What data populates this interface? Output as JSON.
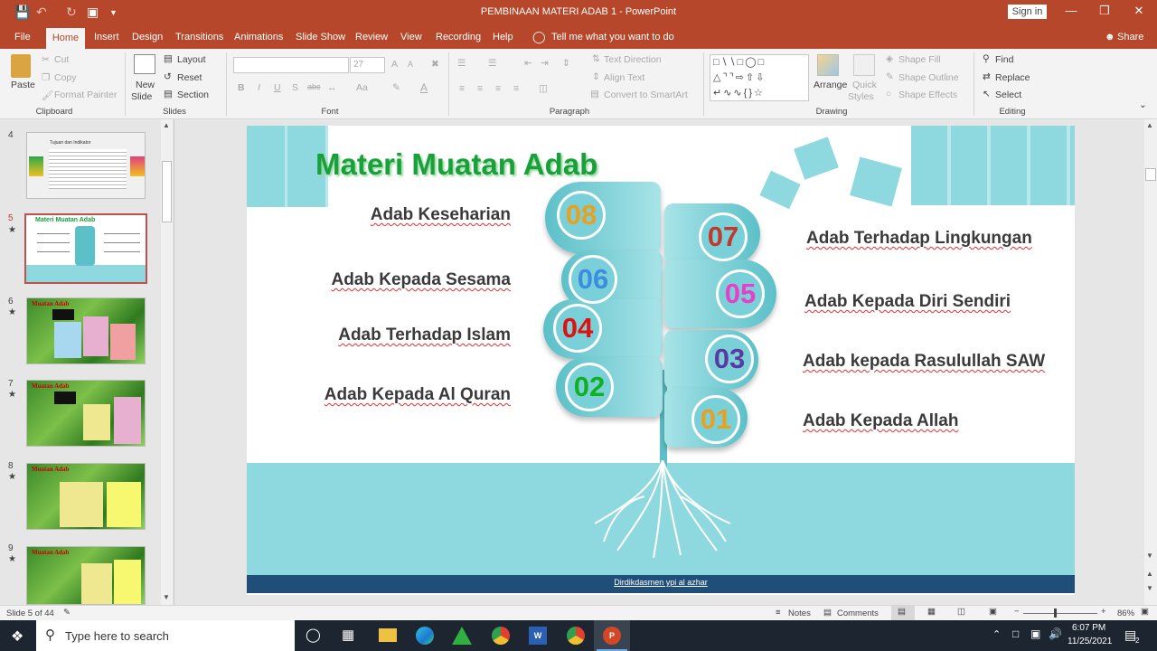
{
  "window": {
    "title": "PEMBINAAN MATERI ADAB 1  -  PowerPoint",
    "sign_in": "Sign in"
  },
  "menu": {
    "tabs": [
      "File",
      "Home",
      "Insert",
      "Design",
      "Transitions",
      "Animations",
      "Slide Show",
      "Review",
      "View",
      "Recording",
      "Help"
    ],
    "tell_me": "Tell me what you want to do",
    "share": "Share"
  },
  "ribbon": {
    "clipboard": {
      "paste": "Paste",
      "cut": "Cut",
      "copy": "Copy",
      "format_painter": "Format Painter",
      "label": "Clipboard"
    },
    "slides": {
      "new_slide_1": "New",
      "new_slide_2": "Slide",
      "layout": "Layout",
      "reset": "Reset",
      "section": "Section",
      "label": "Slides"
    },
    "font": {
      "size": "27",
      "label": "Font",
      "bold": "B",
      "italic": "I",
      "underline": "U",
      "shadow": "S",
      "strike": "abc",
      "grow": "A",
      "shrink": "A",
      "case": "Aa",
      "color": "A"
    },
    "paragraph": {
      "text_direction": "Text Direction",
      "align_text": "Align Text",
      "convert_smartart": "Convert to SmartArt",
      "label": "Paragraph"
    },
    "drawing": {
      "arrange": "Arrange",
      "quick_styles_1": "Quick",
      "quick_styles_2": "Styles",
      "shape_fill": "Shape Fill",
      "shape_outline": "Shape Outline",
      "shape_effects": "Shape Effects",
      "label": "Drawing"
    },
    "editing": {
      "find": "Find",
      "replace": "Replace",
      "select": "Select",
      "label": "Editing"
    }
  },
  "thumbnails": {
    "slides": [
      {
        "num": "4",
        "title": "Tujuan dan Indikator"
      },
      {
        "num": "5",
        "title": "Materi Muatan Adab"
      },
      {
        "num": "6",
        "title": "Muatan Adab"
      },
      {
        "num": "7",
        "title": "Muatan Adab"
      },
      {
        "num": "8",
        "title": "Muatan Adab"
      },
      {
        "num": "9",
        "title": "Muatan Adab"
      }
    ]
  },
  "slide": {
    "title": "Materi Muatan Adab",
    "left_items": [
      "Adab Keseharian",
      "Adab Kepada Sesama",
      "Adab Terhadap Islam",
      "Adab Kepada Al Quran"
    ],
    "right_items": [
      "Adab Terhadap Lingkungan",
      "Adab Kepada Diri Sendiri",
      "Adab kepada Rasulullah SAW",
      "Adab Kepada Allah"
    ],
    "numbers": [
      {
        "label": "08",
        "color": "#e8a020"
      },
      {
        "label": "07",
        "color": "#c0392b"
      },
      {
        "label": "06",
        "color": "#3a8ee0"
      },
      {
        "label": "05",
        "color": "#e83ec8"
      },
      {
        "label": "04",
        "color": "#e01010"
      },
      {
        "label": "03",
        "color": "#5a3aa0"
      },
      {
        "label": "02",
        "color": "#10b020"
      },
      {
        "label": "01",
        "color": "#e8a020"
      }
    ],
    "footer": "Dirdikdasmen ypi al azhar"
  },
  "status": {
    "slide_of": "Slide 5 of 44",
    "notes": "Notes",
    "comments": "Comments",
    "zoom": "86%"
  },
  "taskbar": {
    "search_placeholder": "Type here to search",
    "time": "6:07 PM",
    "date": "11/25/2021",
    "notifications": "2"
  },
  "colors": {
    "accent": "#b7472a",
    "teal": "#8ed8df",
    "title_green": "#18a03a",
    "footer_navy": "#1f4e79"
  }
}
